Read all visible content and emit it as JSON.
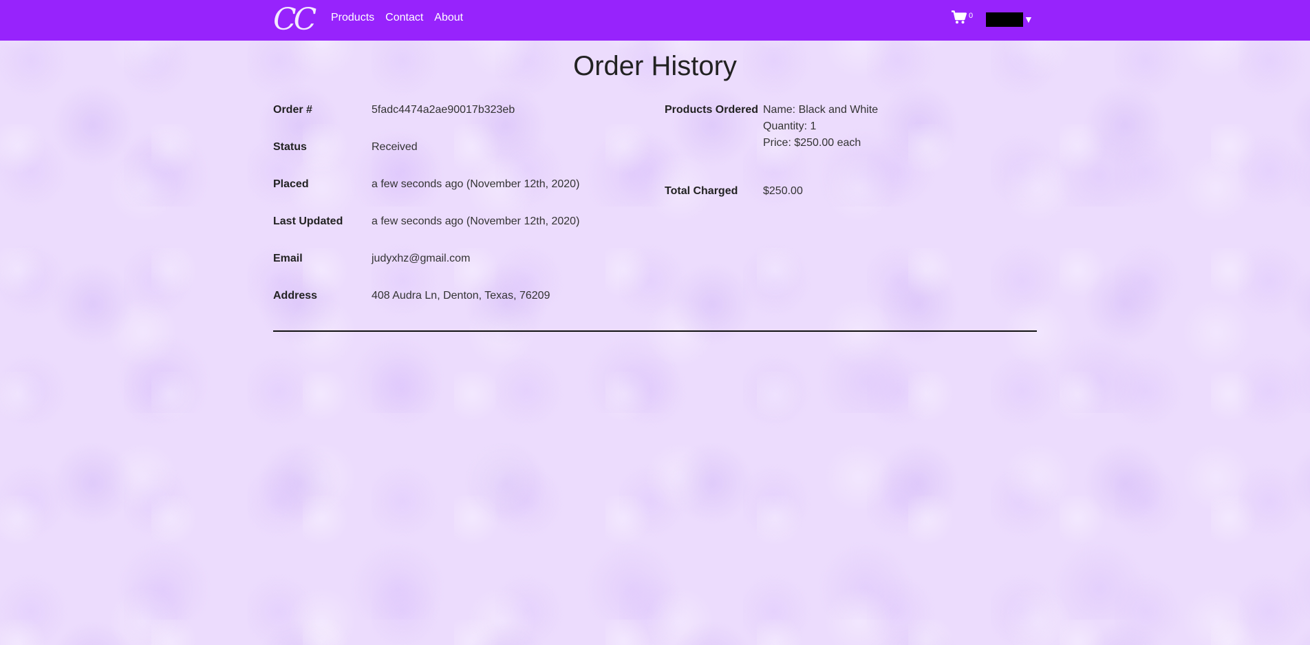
{
  "brand": {
    "logo_text": "CC"
  },
  "nav": {
    "links": [
      "Products",
      "Contact",
      "About"
    ],
    "cart_count": "0"
  },
  "page": {
    "title": "Order History"
  },
  "order": {
    "order_number": {
      "label": "Order #",
      "value": "5fadc4474a2ae90017b323eb"
    },
    "status": {
      "label": "Status",
      "value": "Received"
    },
    "placed": {
      "label": "Placed",
      "value": "a few seconds ago (November 12th, 2020)"
    },
    "last_updated": {
      "label": "Last Updated",
      "value": "a few seconds ago (November 12th, 2020)"
    },
    "email": {
      "label": "Email",
      "value": "judyxhz@gmail.com"
    },
    "address": {
      "label": "Address",
      "value": "408 Audra Ln, Denton, Texas, 76209"
    },
    "products": {
      "label": "Products Ordered",
      "name": "Name: Black and White",
      "quantity": "Quantity: 1",
      "price": "Price: $250.00 each"
    },
    "total": {
      "label": "Total Charged",
      "value": "$250.00"
    }
  },
  "colors": {
    "navbar": "#9723fc",
    "background": "#ecdcfd"
  },
  "icons": {
    "cart": "shopping-cart-icon",
    "dropdown": "caret-down-icon"
  }
}
